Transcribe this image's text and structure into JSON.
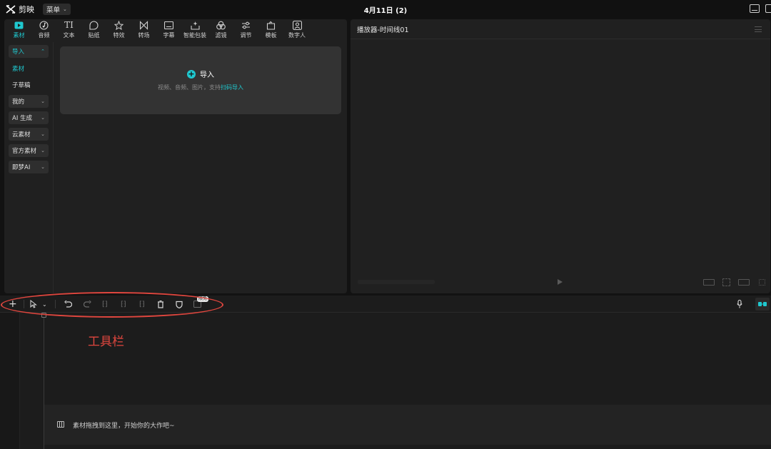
{
  "app": {
    "name": "剪映",
    "menu_label": "菜单",
    "project_title": "4月11日 (2)"
  },
  "tabs": [
    {
      "label": "素材",
      "icon": "media-icon",
      "active": true
    },
    {
      "label": "音频",
      "icon": "audio-icon"
    },
    {
      "label": "文本",
      "icon": "text-icon"
    },
    {
      "label": "贴纸",
      "icon": "sticker-icon"
    },
    {
      "label": "特效",
      "icon": "effects-icon"
    },
    {
      "label": "转场",
      "icon": "transition-icon"
    },
    {
      "label": "字幕",
      "icon": "subtitle-icon"
    },
    {
      "label": "智能包装",
      "icon": "smart-pack-icon"
    },
    {
      "label": "滤镜",
      "icon": "filter-icon"
    },
    {
      "label": "调节",
      "icon": "adjust-icon"
    },
    {
      "label": "模板",
      "icon": "template-icon"
    },
    {
      "label": "数字人",
      "icon": "digital-human-icon"
    }
  ],
  "sidebar": {
    "items": [
      {
        "label": "导入",
        "style": "teal-boxed",
        "chevron": "⌃"
      },
      {
        "label": "素材",
        "style": "teal"
      },
      {
        "label": "子草稿",
        "style": "plain"
      },
      {
        "label": "我的",
        "style": "boxed",
        "chevron": "⌄"
      },
      {
        "label": "AI 生成",
        "style": "boxed",
        "chevron": "⌄"
      },
      {
        "label": "云素材",
        "style": "boxed",
        "chevron": "⌄"
      },
      {
        "label": "官方素材",
        "style": "boxed",
        "chevron": "⌄"
      },
      {
        "label": "即梦AI",
        "style": "boxed",
        "chevron": "⌄"
      }
    ]
  },
  "import_zone": {
    "title": "导入",
    "subtitle": "视频、音频、图片，支持",
    "link": "扫码导入"
  },
  "player": {
    "title": "播放器-时间线01"
  },
  "timeline": {
    "annotation": "工具栏",
    "badge": "限免",
    "drop_hint": "素材拖拽到这里，开始你的大作吧~"
  },
  "colors": {
    "accent": "#1fc8cf",
    "annotation": "#e0463e",
    "bg": "#121212",
    "panel": "#202020"
  }
}
